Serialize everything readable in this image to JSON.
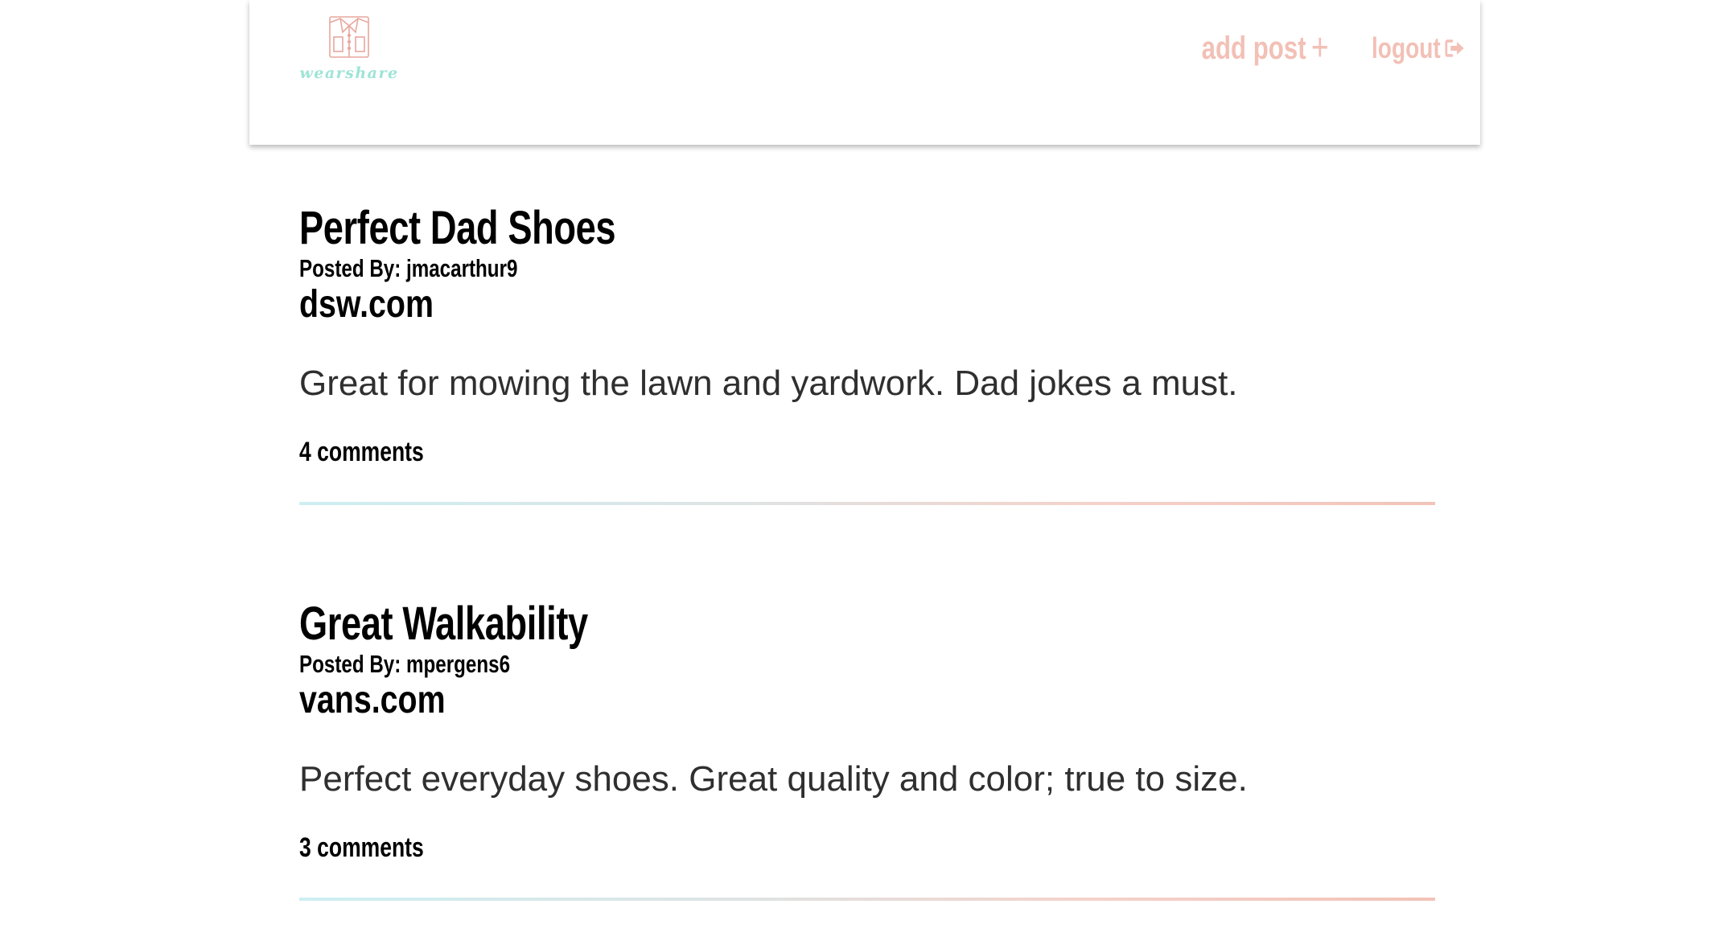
{
  "header": {
    "logo_text": "wearshare",
    "nav": {
      "add_post_label": "add post",
      "add_post_icon": "+",
      "logout_label": "logout"
    }
  },
  "colors": {
    "accent_pink": "#f2c0b6",
    "accent_teal": "#9ee4d6",
    "text_dark": "#000000",
    "body_text": "#2f2f2f"
  },
  "posts": [
    {
      "title": "Perfect Dad Shoes",
      "posted_by": "Posted By: jmacarthur9",
      "site": "dsw.com",
      "body": "Great for mowing the lawn and yardwork. Dad jokes a must.",
      "comments": "4 comments"
    },
    {
      "title": "Great Walkability",
      "posted_by": "Posted By: mpergens6",
      "site": "vans.com",
      "body": "Perfect everyday shoes. Great quality and color; true to size.",
      "comments": "3 comments"
    }
  ]
}
